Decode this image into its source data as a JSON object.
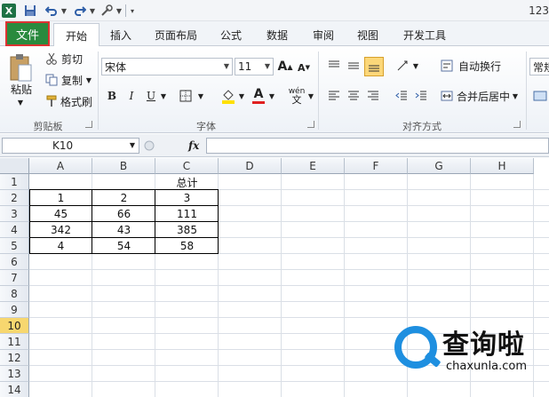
{
  "titlebar": {
    "excel_logo": "X",
    "window_title": "123",
    "icons": [
      "excel-icon",
      "save-icon",
      "undo-icon",
      "redo-icon",
      "tool-icon"
    ]
  },
  "tabs": {
    "file": "文件",
    "items": [
      "开始",
      "插入",
      "页面布局",
      "公式",
      "数据",
      "审阅",
      "视图",
      "开发工具"
    ]
  },
  "ribbon": {
    "clipboard": {
      "paste": "粘贴",
      "cut": "剪切",
      "copy": "复制",
      "format_painter": "格式刷",
      "label": "剪贴板"
    },
    "font": {
      "name": "宋体",
      "size": "11",
      "bold": "B",
      "italic": "I",
      "underline": "U",
      "label": "字体",
      "grow": "A",
      "shrink": "A",
      "fill_glyph": "A",
      "wen": "wén"
    },
    "alignment": {
      "wrap": "自动换行",
      "merge": "合并后居中",
      "label": "对齐方式"
    },
    "number": {
      "format": "常规"
    },
    "colors": {
      "font_color": "#e02020",
      "fill_color": "#ffe000",
      "file_tab": "#2a8a3e"
    }
  },
  "formula_bar": {
    "cell_ref": "K10",
    "fx": "fx",
    "content": ""
  },
  "grid": {
    "columns": [
      "A",
      "B",
      "C",
      "D",
      "E",
      "F",
      "G",
      "H"
    ],
    "rows": [
      "1",
      "2",
      "3",
      "4",
      "5",
      "6",
      "7",
      "8",
      "9",
      "10",
      "11",
      "12",
      "13",
      "14"
    ],
    "selected_row": "10",
    "cells": [
      {
        "row": 1,
        "col": 2,
        "value": "总计"
      },
      {
        "row": 2,
        "col": 0,
        "value": "1"
      },
      {
        "row": 2,
        "col": 1,
        "value": "2"
      },
      {
        "row": 2,
        "col": 2,
        "value": "3"
      },
      {
        "row": 3,
        "col": 0,
        "value": "45"
      },
      {
        "row": 3,
        "col": 1,
        "value": "66"
      },
      {
        "row": 3,
        "col": 2,
        "value": "111"
      },
      {
        "row": 4,
        "col": 0,
        "value": "342"
      },
      {
        "row": 4,
        "col": 1,
        "value": "43"
      },
      {
        "row": 4,
        "col": 2,
        "value": "385"
      },
      {
        "row": 5,
        "col": 0,
        "value": "4"
      },
      {
        "row": 5,
        "col": 1,
        "value": "54"
      },
      {
        "row": 5,
        "col": 2,
        "value": "58"
      }
    ]
  },
  "watermark": {
    "title": "查询啦",
    "url": "chaxunla.com"
  }
}
